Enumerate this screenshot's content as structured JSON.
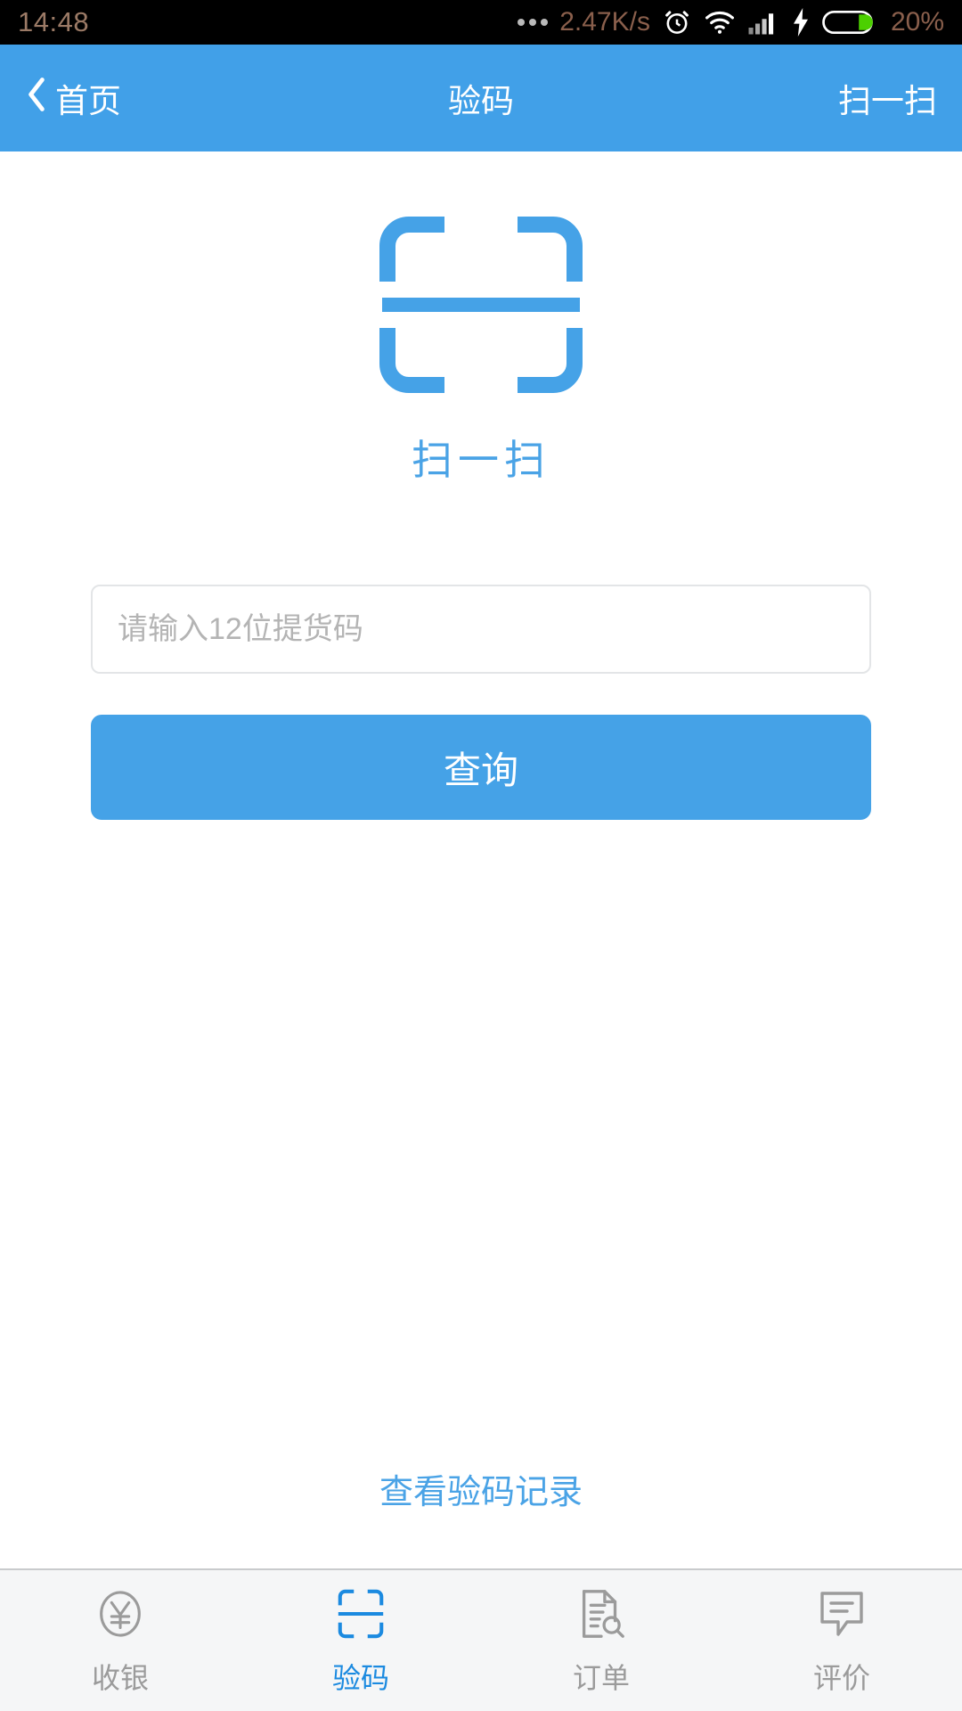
{
  "statusbar": {
    "time": "14:48",
    "network_speed": "2.47K/s",
    "battery_percent": "20%",
    "icons": [
      "more-dots-icon",
      "alarm-clock-icon",
      "wifi-icon",
      "signal-bars-icon",
      "charging-bolt-icon",
      "battery-icon"
    ]
  },
  "header": {
    "back_label": "首页",
    "back_chevron": "‹",
    "title": "验码",
    "action_label": "扫一扫",
    "accent_color": "#41a0e8"
  },
  "main": {
    "scan_label": "扫一扫",
    "scan_icon": "scan-frame-icon",
    "input": {
      "placeholder": "请输入12位提货码",
      "value": ""
    },
    "query_label": "查询",
    "records_link": "查看验码记录"
  },
  "tabbar": {
    "items": [
      {
        "label": "收银",
        "icon": "yen-circle-icon",
        "active": false
      },
      {
        "label": "验码",
        "icon": "scan-frame-icon",
        "active": true
      },
      {
        "label": "订单",
        "icon": "document-search-icon",
        "active": false
      },
      {
        "label": "评价",
        "icon": "speech-bubble-icon",
        "active": false
      }
    ],
    "active_color": "#1b8ae0",
    "inactive_color": "#9b9b9b"
  }
}
